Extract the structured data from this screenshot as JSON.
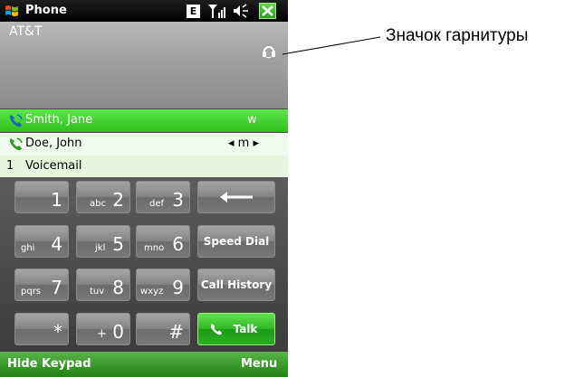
{
  "titlebar": {
    "title": "Phone",
    "edge_indicator": "E",
    "icons": [
      "windows-start-icon",
      "signal-icon",
      "speaker-icon",
      "close-icon"
    ]
  },
  "carrier": {
    "name": "AT&T",
    "icon": "headset-icon"
  },
  "contacts": [
    {
      "name": "Smith, Jane",
      "type": "w",
      "selected": true
    },
    {
      "name": "Doe, John",
      "type": "◂ m ▸",
      "selected": false
    },
    {
      "number": "1",
      "name": "Voicemail",
      "selected": false
    }
  ],
  "keypad": {
    "keys": [
      {
        "digit": "1",
        "letters": ""
      },
      {
        "digit": "2",
        "letters": "abc"
      },
      {
        "digit": "3",
        "letters": "def"
      },
      {
        "digit": "4",
        "letters": "ghi"
      },
      {
        "digit": "5",
        "letters": "jkl"
      },
      {
        "digit": "6",
        "letters": "mno"
      },
      {
        "digit": "7",
        "letters": "pqrs"
      },
      {
        "digit": "8",
        "letters": "tuv"
      },
      {
        "digit": "9",
        "letters": "wxyz"
      },
      {
        "digit": "*",
        "letters": ""
      },
      {
        "digit": "0",
        "letters": "+"
      },
      {
        "digit": "#",
        "letters": ""
      }
    ],
    "backspace_icon": "backspace-arrow-icon",
    "speed_dial": "Speed Dial",
    "call_history": "Call History",
    "talk": "Talk"
  },
  "softkeys": {
    "left": "Hide Keypad",
    "right": "Menu"
  },
  "callout": {
    "label": "Значок гарнитуры"
  },
  "colors": {
    "accent_green": "#2fbf1f",
    "titlebar": "#000000",
    "keypad_bg": "#4a4a4a"
  }
}
